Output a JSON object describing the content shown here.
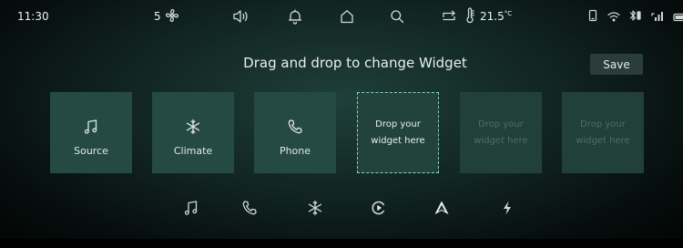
{
  "status": {
    "time": "11:30",
    "fan_speed": "5",
    "temperature": "21.5",
    "temperature_unit": "°C"
  },
  "header": {
    "title": "Drag and drop to change Widget",
    "save_label": "Save"
  },
  "widgets": [
    {
      "icon": "music-note-icon",
      "label": "Source"
    },
    {
      "icon": "snowflake-icon",
      "label": "Climate"
    },
    {
      "icon": "phone-icon",
      "label": "Phone"
    }
  ],
  "drop_slots": [
    {
      "line1": "Drop your",
      "line2": "widget here",
      "state": "active"
    },
    {
      "line1": "Drop your",
      "line2": "widget here",
      "state": "inactive"
    },
    {
      "line1": "Drop your",
      "line2": "widget here",
      "state": "inactive"
    }
  ],
  "dock": [
    "music-note-icon",
    "phone-icon",
    "snowflake-icon",
    "play-circle-icon",
    "navigation-arrow-icon",
    "lightning-icon"
  ],
  "colors": {
    "background": "#10231f",
    "tile": "#254a43",
    "accent_border": "#8fd0c0",
    "save_button": "#2a3d39"
  }
}
